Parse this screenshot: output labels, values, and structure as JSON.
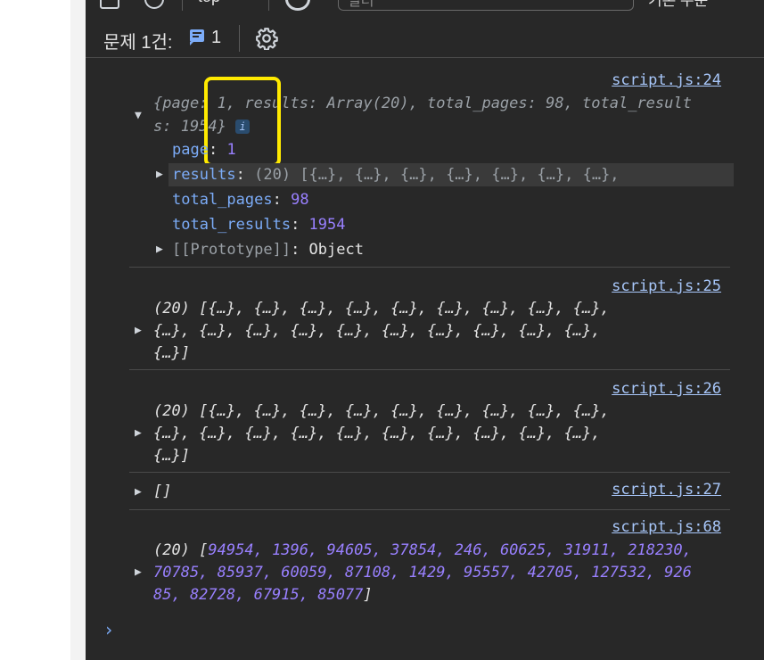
{
  "toolbar": {
    "context": "top",
    "filter_placeholder": "필터",
    "levels": "기본 수준"
  },
  "issues": {
    "label": "문제 1건:",
    "count": "1"
  },
  "console": {
    "messages": [
      {
        "source": "script.js:24",
        "summary_line1": "{page: 1, results: Array(20), total_pages: 98, total_result",
        "summary_line2": "s: 1954}",
        "info_badge": "i",
        "props": [
          {
            "key": "page",
            "value": "1"
          },
          {
            "key": "results",
            "value": "(20) [{…}, {…}, {…}, {…}, {…}, {…}, {…},"
          },
          {
            "key": "total_pages",
            "value": "98"
          },
          {
            "key": "total_results",
            "value": "1954"
          },
          {
            "key": "[[Prototype]]",
            "value": "Object"
          }
        ]
      },
      {
        "source": "script.js:25",
        "lines": [
          "(20) [{…}, {…}, {…}, {…}, {…}, {…}, {…}, {…}, {…},",
          "{…}, {…}, {…}, {…}, {…}, {…}, {…}, {…}, {…}, {…},",
          "{…}]"
        ]
      },
      {
        "source": "script.js:26",
        "lines": [
          "(20) [{…}, {…}, {…}, {…}, {…}, {…}, {…}, {…}, {…},",
          "{…}, {…}, {…}, {…}, {…}, {…}, {…}, {…}, {…}, {…},",
          "{…}]"
        ]
      },
      {
        "source": "script.js:27",
        "text": "[]"
      },
      {
        "source": "script.js:68",
        "prefix": "(20) [",
        "line1_nums": "94954, 1396, 94605, 37854, 246, 60625, 31911, 218230,",
        "line2_nums": "70785, 85937, 60059, 87108, 1429, 95557, 42705, 127532, 926",
        "line3_nums": "85, 82728, 67915, 85077",
        "suffix": "]"
      }
    ],
    "prompt": "›"
  },
  "colors": {
    "background": "#282828",
    "highlight": "#ffea00",
    "link": "#a8c7fa",
    "number": "#9980ff",
    "property": "#7cacf8"
  }
}
